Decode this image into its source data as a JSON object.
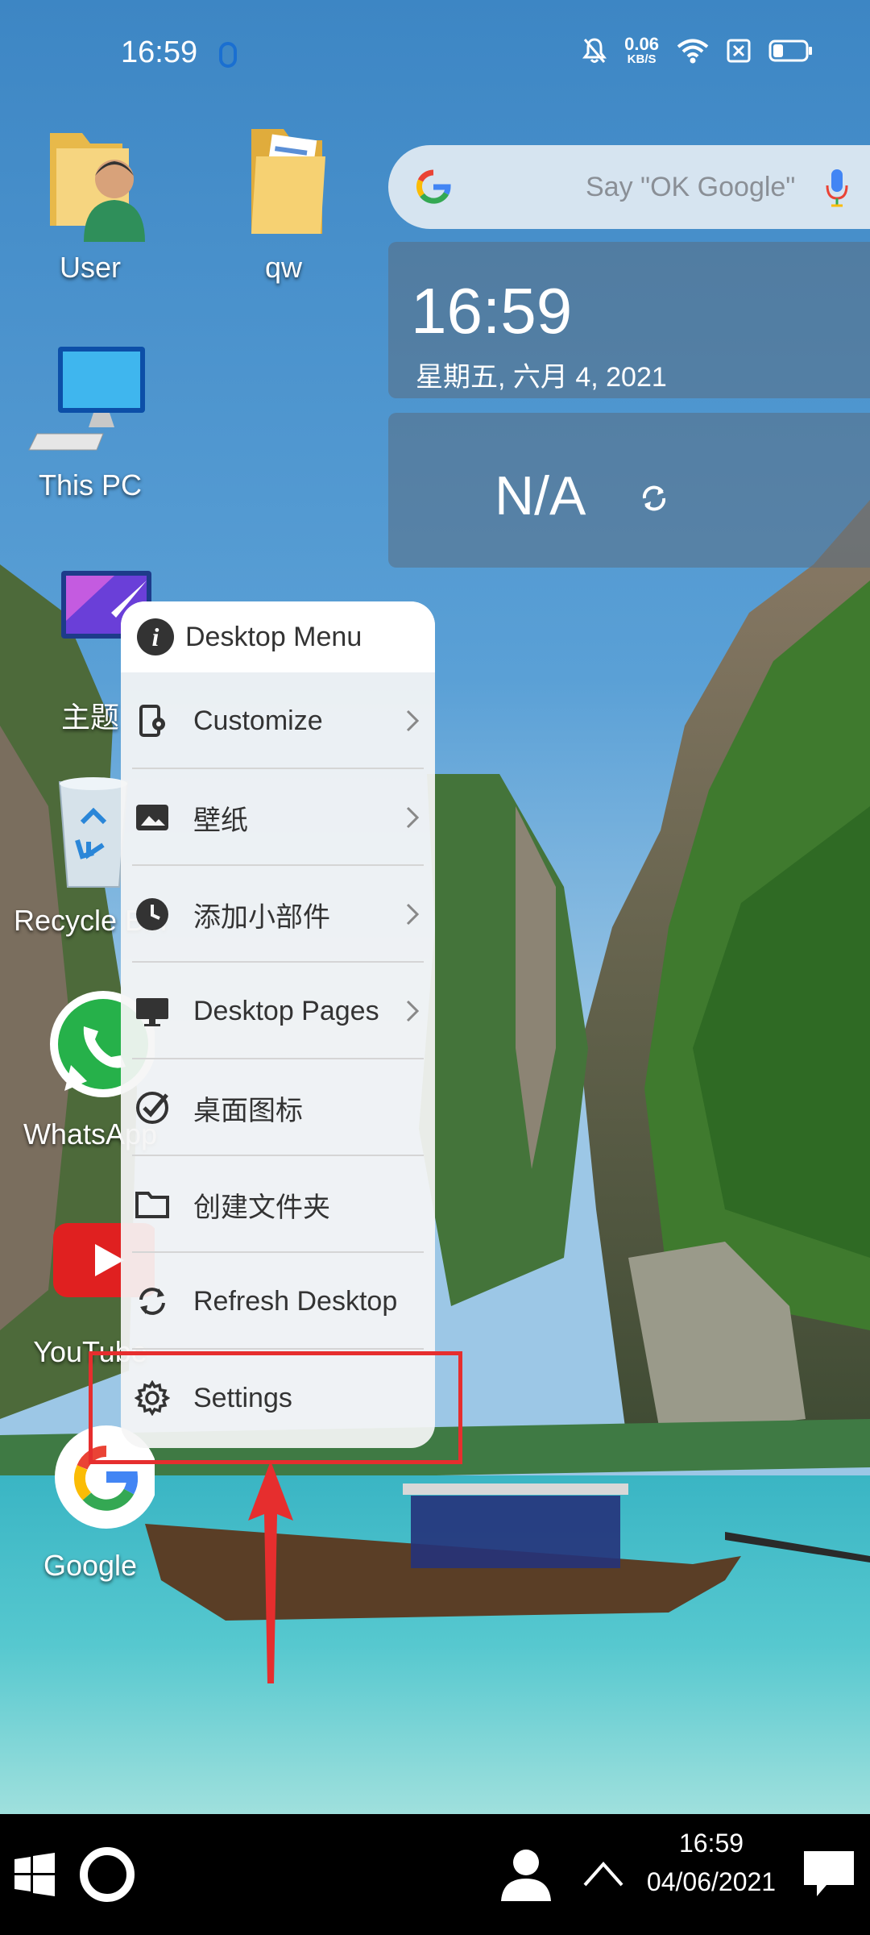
{
  "status_bar": {
    "time": "16:59",
    "net_speed_value": "0.06",
    "net_speed_unit": "KB/S"
  },
  "desktop_icons": [
    {
      "label": "User"
    },
    {
      "label": "qw"
    },
    {
      "label": "This PC"
    },
    {
      "label": "主题"
    },
    {
      "label": "Recycle Bin"
    },
    {
      "label": "WhatsApp"
    },
    {
      "label": "YouTube"
    },
    {
      "label": "Google"
    }
  ],
  "search_widget": {
    "placeholder": "Say \"OK Google\""
  },
  "clock_widget": {
    "time": "16:59",
    "date": "星期五, 六月 4, 2021"
  },
  "weather_widget": {
    "text": "N/A"
  },
  "desktop_menu": {
    "title": "Desktop Menu",
    "items": [
      {
        "label": "Customize",
        "icon": "customize-icon",
        "submenu": true
      },
      {
        "label": "壁纸",
        "icon": "wallpaper-icon",
        "submenu": true
      },
      {
        "label": "添加小部件",
        "icon": "clock-widget-icon",
        "submenu": true
      },
      {
        "label": "Desktop Pages",
        "icon": "monitor-icon",
        "submenu": true
      },
      {
        "label": "桌面图标",
        "icon": "check-circle-icon",
        "submenu": false
      },
      {
        "label": "创建文件夹",
        "icon": "folder-icon",
        "submenu": false
      },
      {
        "label": "Refresh Desktop",
        "icon": "refresh-icon",
        "submenu": false
      },
      {
        "label": "Settings",
        "icon": "gear-icon",
        "submenu": false
      }
    ]
  },
  "taskbar": {
    "time": "16:59",
    "date": "04/06/2021"
  },
  "colors": {
    "accent_red": "#e62e2e",
    "menu_bg": "#f5f5f5",
    "taskbar_bg": "#000000"
  }
}
